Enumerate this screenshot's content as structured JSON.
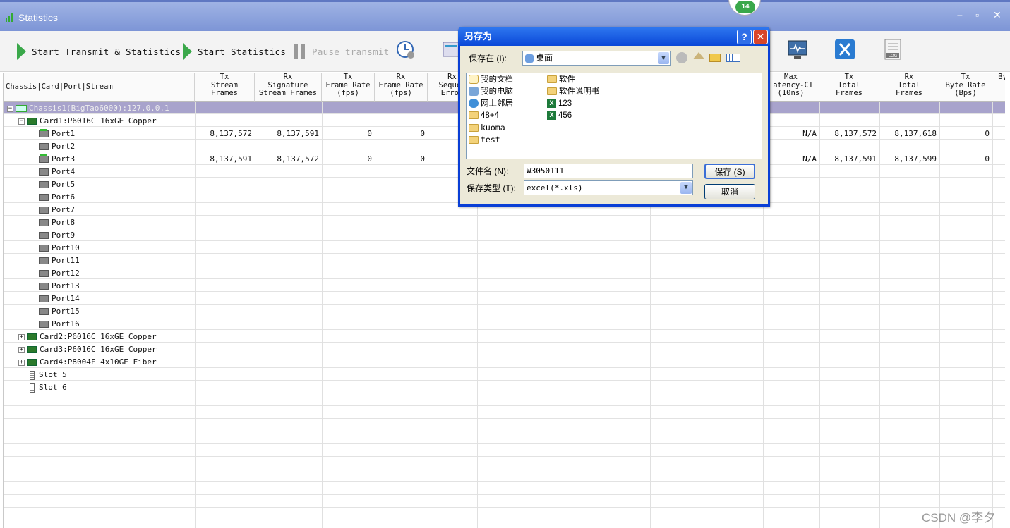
{
  "window": {
    "title": "Statistics",
    "minimize": "–",
    "restore": "▫",
    "close": "✕",
    "badge": "14"
  },
  "toolbar": {
    "start_tx_stats": "Start Transmit & Statistics",
    "start_stats": "Start Statistics",
    "pause_tx": "Pause transmit"
  },
  "grid": {
    "headers": [
      "Chassis|Card|Port|Stream",
      "Tx\nStream\nFrames",
      "Rx\nSignature\nStream Frames",
      "Tx\nFrame Rate\n(fps)",
      "Rx\nFrame Rate\n(fps)",
      "Rx\nSequen\nError",
      "Max\nLatency-CT\n(10ns)",
      "Tx\nTotal\nFrames",
      "Rx\nTotal\nFrames",
      "Tx\nByte Rate\n(Bps)",
      "By"
    ],
    "chassis": "Chassis1(BigTao6000):127.0.0.1",
    "card1": "Card1:P6016C 16xGE Copper",
    "ports": [
      "Port1",
      "Port2",
      "Port3",
      "Port4",
      "Port5",
      "Port6",
      "Port7",
      "Port8",
      "Port9",
      "Port10",
      "Port11",
      "Port12",
      "Port13",
      "Port14",
      "Port15",
      "Port16"
    ],
    "port1": {
      "tx_stream": "8,137,572",
      "rx_sig": "8,137,591",
      "tx_rate": "0",
      "rx_rate": "0",
      "max_lat": "N/A",
      "tx_total": "8,137,572",
      "rx_total": "8,137,618",
      "tx_byte": "0"
    },
    "port3": {
      "tx_stream": "8,137,591",
      "rx_sig": "8,137,572",
      "tx_rate": "0",
      "rx_rate": "0",
      "max_lat": "N/A",
      "tx_total": "8,137,591",
      "rx_total": "8,137,599",
      "tx_byte": "0"
    },
    "card2": "Card2:P6016C 16xGE Copper",
    "card3": "Card3:P6016C 16xGE Copper",
    "card4": "Card4:P8004F 4x10GE Fiber",
    "slot5": "Slot 5",
    "slot6": "Slot 6"
  },
  "dialog": {
    "title": "另存为",
    "help": "?",
    "close": "✕",
    "save_in_label": "保存在 (I):",
    "save_in_value": "桌面",
    "items_left": [
      "我的文档",
      "我的电脑",
      "网上邻居",
      "48+4",
      "kuoma",
      "test"
    ],
    "items_right": [
      "软件",
      "软件说明书",
      "123",
      "456"
    ],
    "filename_label": "文件名 (N):",
    "filename_value": "W3050111",
    "filetype_label": "保存类型 (T):",
    "filetype_value": "excel(*.xls)",
    "save_button": "保存 (S)",
    "cancel_button": "取消"
  },
  "watermark": "CSDN @李夕"
}
